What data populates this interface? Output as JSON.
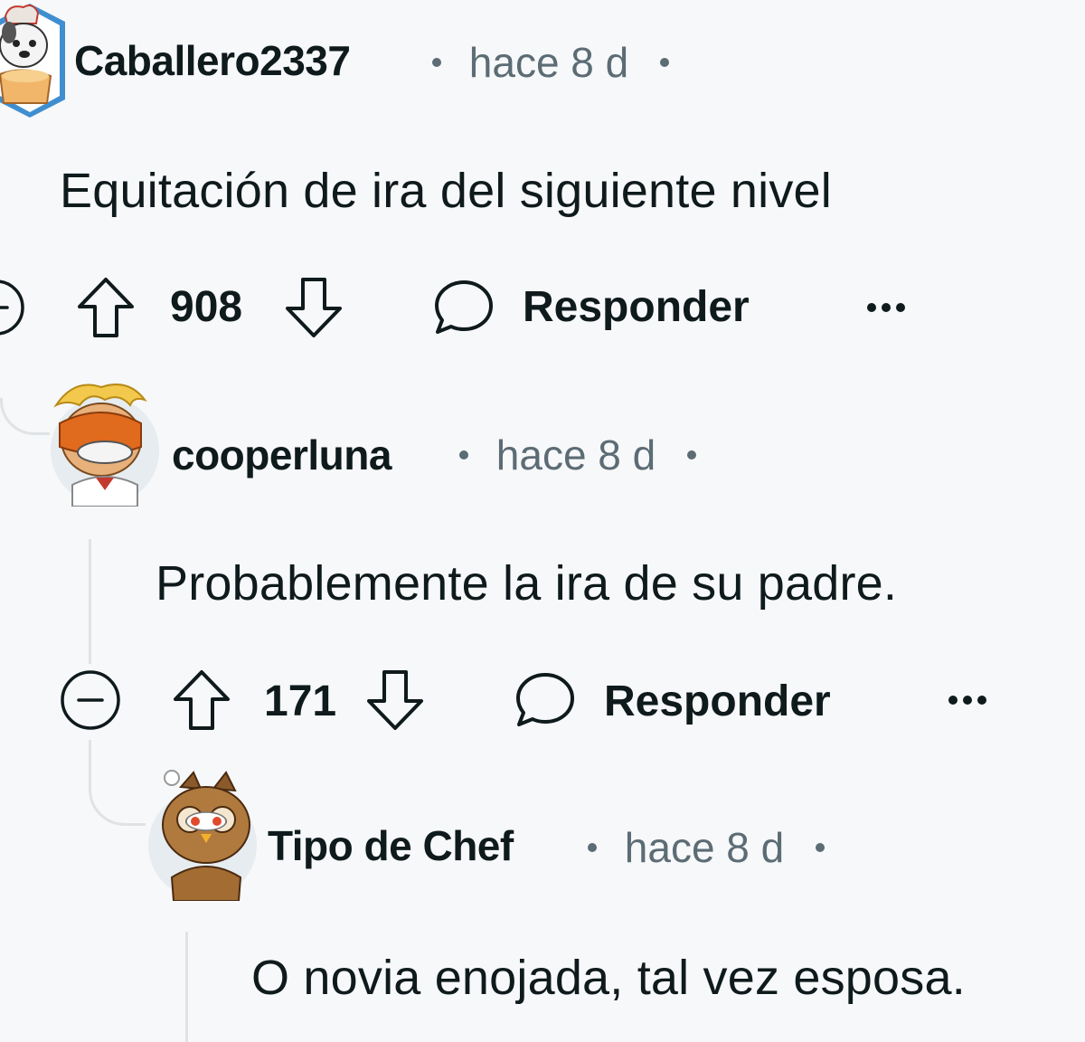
{
  "comments": [
    {
      "username": "Caballero2337",
      "timestamp": "hace 8 d",
      "text": "Equitación de ira del siguiente nivel",
      "votes": "908",
      "reply_label": "Responder",
      "avatar_icon": "dog-chef-avatar-icon"
    },
    {
      "username": "cooperluna",
      "timestamp": "hace 8 d",
      "text": "Probablemente la ira de su padre.",
      "votes": "171",
      "reply_label": "Responder",
      "avatar_icon": "chef-goggles-avatar-icon"
    },
    {
      "username": "Tipo de Chef",
      "timestamp": "hace 8 d",
      "text": "O novia enojada, tal vez esposa.",
      "avatar_icon": "owl-chef-avatar-icon"
    }
  ],
  "colors": {
    "background": "#f7f8fa",
    "text": "#0f1a1c",
    "meta": "#5c6c74",
    "thread_line": "#dfe3e6"
  }
}
